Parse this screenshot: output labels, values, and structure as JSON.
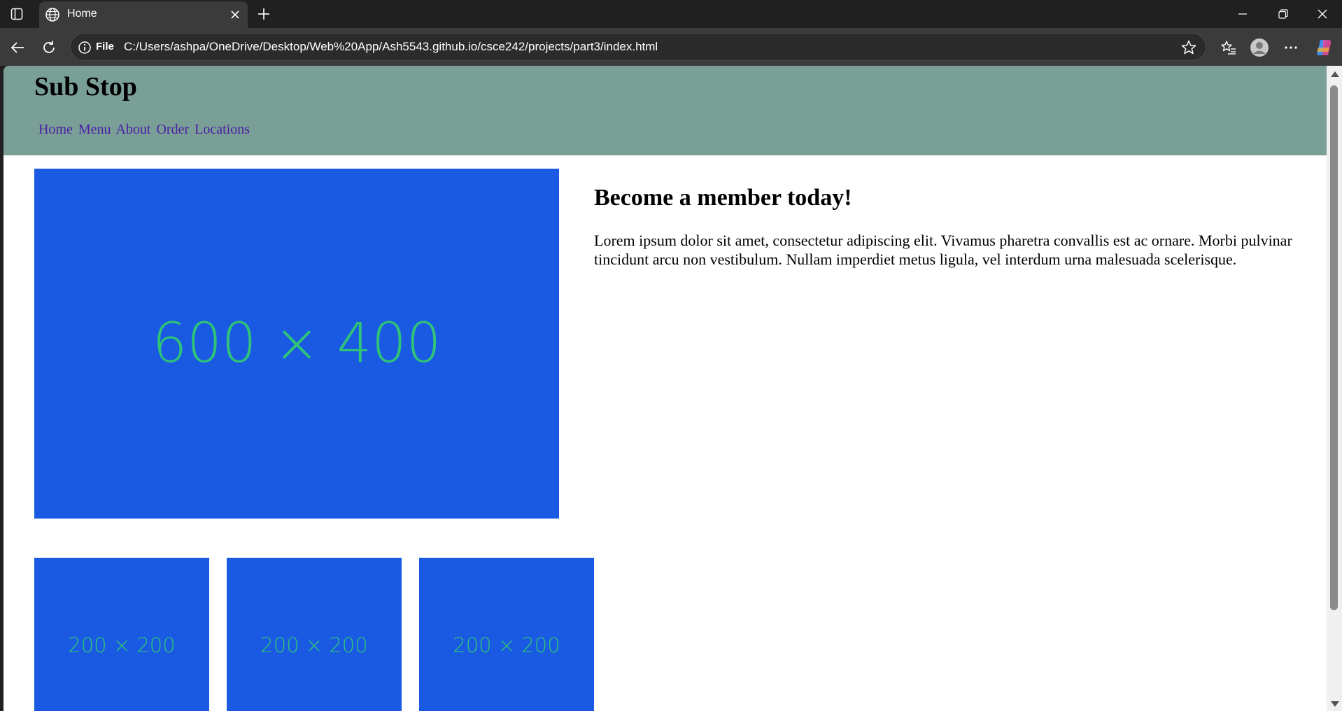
{
  "browser": {
    "tab_title": "Home",
    "address_prefix": "File",
    "url": "C:/Users/ashpa/OneDrive/Desktop/Web%20App/Ash5543.github.io/csce242/projects/part3/index.html"
  },
  "site": {
    "title": "Sub Stop",
    "nav": [
      "Home",
      "Menu",
      "About",
      "Order",
      "Locations"
    ]
  },
  "hero": {
    "image_label": "600 × 400"
  },
  "promo": {
    "heading": "Become a member today!",
    "body": "Lorem ipsum dolor sit amet, consectetur adipiscing elit. Vivamus pharetra convallis est ac ornare. Morbi pulvinar tincidunt arcu non vestibulum. Nullam imperdiet metus ligula, vel interdum urna malesuada scelerisque."
  },
  "thumbnails": [
    "200 × 200",
    "200 × 200",
    "200 × 200"
  ],
  "colors": {
    "header_bg": "#7a9f96",
    "placeholder_bg": "#1a5ae2",
    "placeholder_text": "#2fc478",
    "nav_link": "#4b1fa6"
  }
}
